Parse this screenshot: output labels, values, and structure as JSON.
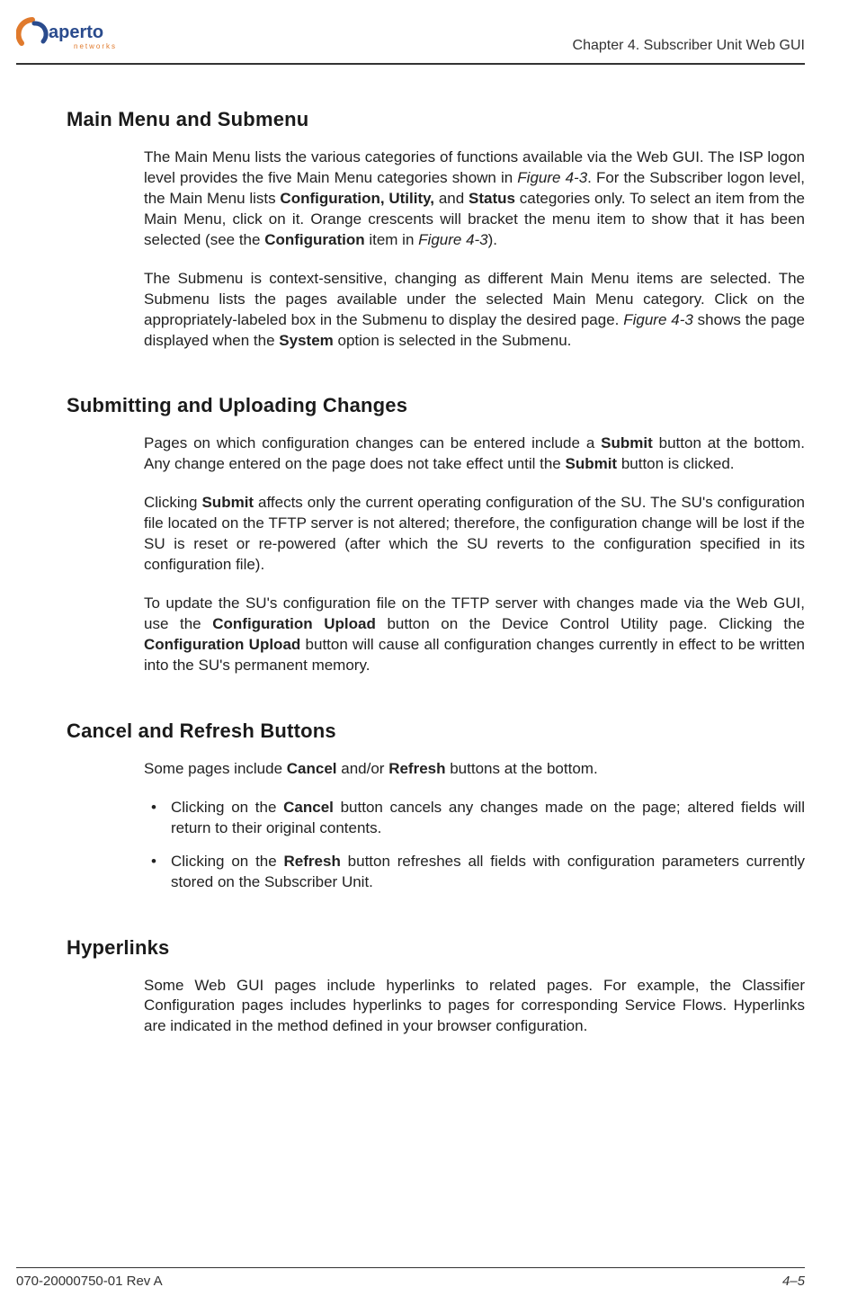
{
  "header": {
    "logo_brand_main": "aperto",
    "logo_brand_sub": "networks",
    "chapter": "Chapter 4.  Subscriber Unit Web GUI"
  },
  "sections": {
    "main_menu": {
      "heading": "Main Menu and Submenu",
      "p1a": "The Main Menu lists the various categories of functions available via the Web GUI. The ISP logon level provides the five Main Menu categories shown in ",
      "p1_fig": "Figure 4-3",
      "p1b": ". For the Subscriber logon level, the Main Menu lists ",
      "p1_b1": "Configuration, Utility,",
      "p1c": " and ",
      "p1_b2": "Status",
      "p1d": " categories only. To select an item from the Main Menu, click on it. Orange crescents will bracket the menu item to show that it has been selected (see the ",
      "p1_b3": "Configuration",
      "p1e": " item in ",
      "p1_fig2": "Figure 4-3",
      "p1f": ").",
      "p2a": "The Submenu is context-sensitive, changing as different Main Menu items are selected. The Submenu lists the pages available under the selected Main Menu category. Click on the appropriately-labeled box in the Submenu to display the desired page. ",
      "p2_fig": "Figure 4-3",
      "p2b": " shows the page displayed when the ",
      "p2_b1": "System",
      "p2c": " option is selected in the Submenu."
    },
    "submit": {
      "heading": "Submitting and Uploading Changes",
      "p1a": "Pages on which configuration changes can be entered include a ",
      "p1_b1": "Submit",
      "p1b": " button at the bottom. Any change entered on the page does not take effect until the ",
      "p1_b2": "Submit",
      "p1c": " button is clicked.",
      "p2a": "Clicking ",
      "p2_b1": "Submit",
      "p2b": " affects only the current operating configuration of the SU. The SU's configuration file located on the  TFTP server is not altered; therefore, the configuration change will be lost if the SU is reset or re-powered (after which the SU reverts to the configuration specified in its configuration file).",
      "p3a": "To update the SU's configuration file on the TFTP server with changes made via the Web GUI, use the ",
      "p3_b1": "Configuration Upload",
      "p3b": " button on the Device Control Utility page. Clicking the ",
      "p3_b2": "Configuration Upload",
      "p3c": " button will cause all configuration changes currently in effect to be written into the SU's permanent memory."
    },
    "cancel": {
      "heading": "Cancel and Refresh Buttons",
      "p1a": "Some pages include ",
      "p1_b1": "Cancel",
      "p1b": " and/or ",
      "p1_b2": "Refresh",
      "p1c": " buttons at the bottom.",
      "li1a": "Clicking on the ",
      "li1_b1": "Cancel",
      "li1b": " button cancels any changes made on the page; altered fields will return to their original contents.",
      "li2a": "Clicking on the ",
      "li2_b1": "Refresh",
      "li2b": " button refreshes all fields with configuration parameters currently stored on the Subscriber Unit."
    },
    "hyper": {
      "heading": "Hyperlinks",
      "p1": "Some Web GUI pages include hyperlinks to related pages. For example, the Classifier Configuration pages includes hyperlinks to pages for corresponding Service Flows. Hyperlinks are indicated in the method defined in your browser configuration."
    }
  },
  "footer": {
    "doc_id": "070-20000750-01 Rev A",
    "page": "4–5"
  }
}
